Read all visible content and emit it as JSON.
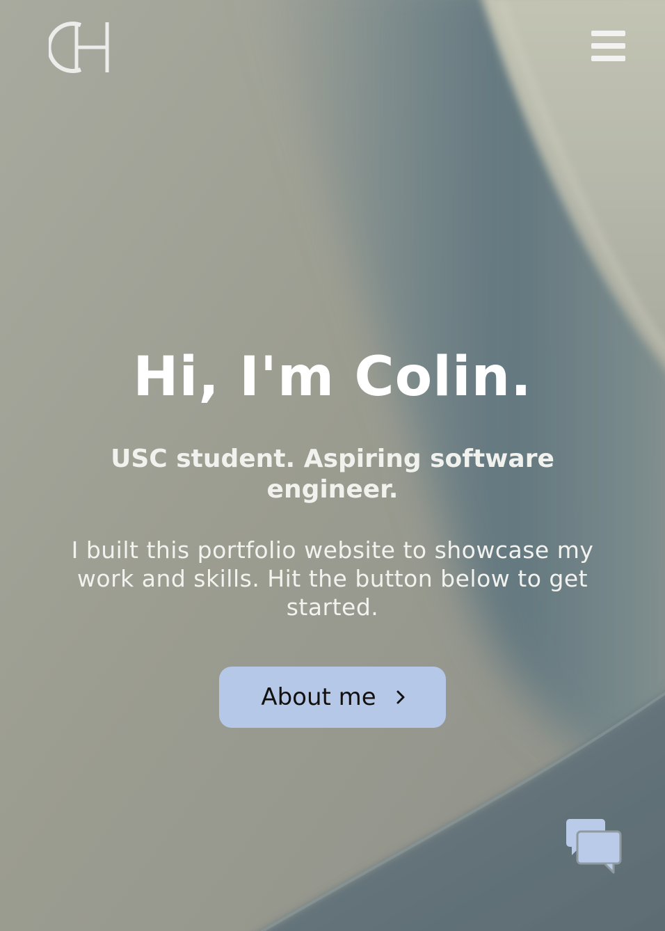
{
  "header": {
    "logo_text": "CH",
    "logo_icon": "monogram-logo-icon",
    "menu_icon": "hamburger-menu-icon"
  },
  "hero": {
    "title": "Hi, I'm Colin.",
    "subtitle": "USC student. Aspiring software engineer.",
    "description": "I built this portfolio website to showcase my work and skills. Hit the button below to get started.",
    "cta_label": "About me",
    "cta_icon": "chevron-right-icon"
  },
  "chat": {
    "icon": "chat-bubbles-icon"
  },
  "colors": {
    "button_background": "#b6c8e8",
    "chat_icon": "#b9cbe9",
    "text": "#ffffff"
  }
}
